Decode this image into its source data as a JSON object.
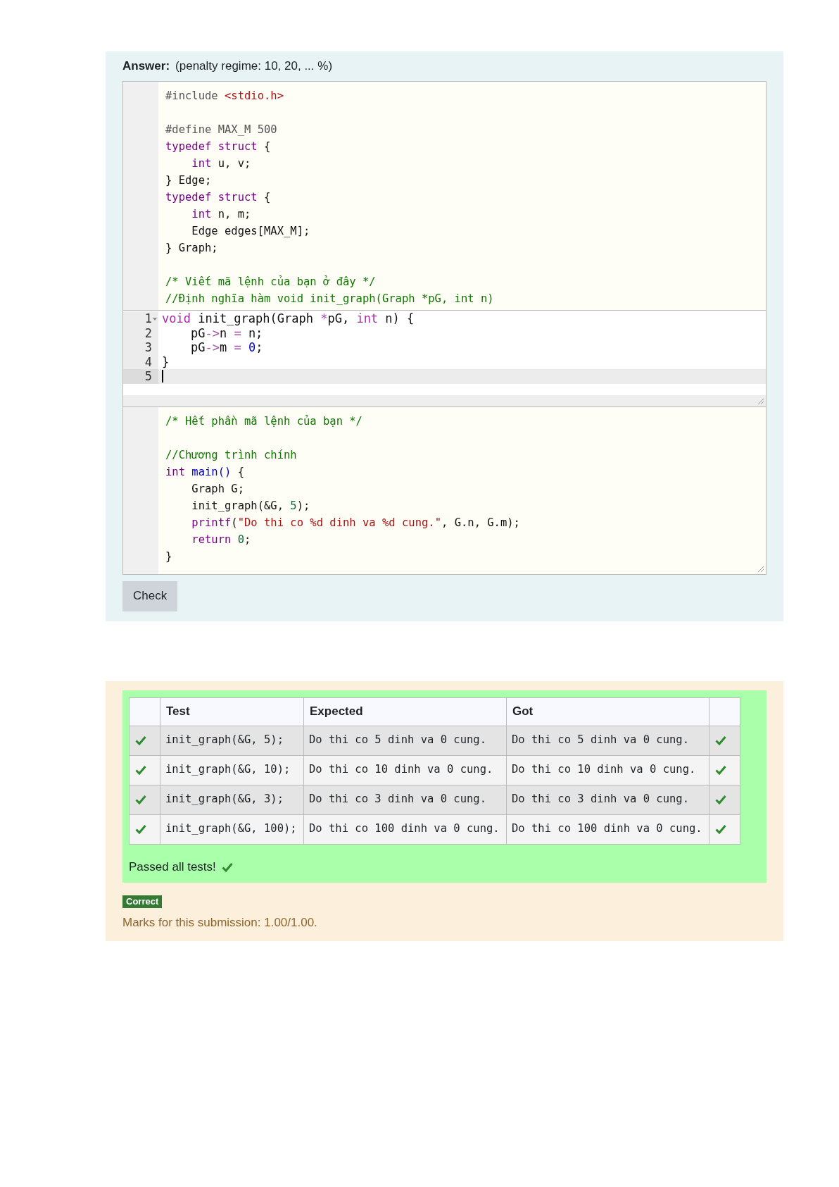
{
  "answer": {
    "label": "Answer:",
    "penalty": "(penalty regime: 10, 20, ... %)",
    "prefix_code": [
      {
        "kind": "code",
        "tokens": [
          {
            "kind": "meta",
            "text": "#include "
          },
          {
            "kind": "string",
            "text": "<stdio.h>"
          }
        ]
      },
      {
        "kind": "blank"
      },
      {
        "kind": "code",
        "tokens": [
          {
            "kind": "meta",
            "text": "#define MAX_M 500"
          }
        ]
      },
      {
        "kind": "code",
        "tokens": [
          {
            "kind": "keyword",
            "text": "typedef struct"
          },
          {
            "kind": "plain",
            "text": " {"
          }
        ]
      },
      {
        "kind": "code",
        "tokens": [
          {
            "kind": "keyword",
            "text": "    int"
          },
          {
            "kind": "plain",
            "text": " u, v;"
          }
        ]
      },
      {
        "kind": "code",
        "tokens": [
          {
            "kind": "plain",
            "text": "} Edge;"
          }
        ]
      },
      {
        "kind": "code",
        "tokens": [
          {
            "kind": "keyword",
            "text": "typedef struct"
          },
          {
            "kind": "plain",
            "text": " {"
          }
        ]
      },
      {
        "kind": "code",
        "tokens": [
          {
            "kind": "keyword",
            "text": "    int"
          },
          {
            "kind": "plain",
            "text": " n, m;"
          }
        ]
      },
      {
        "kind": "code",
        "tokens": [
          {
            "kind": "plain",
            "text": "    Edge edges[MAX_M];"
          }
        ]
      },
      {
        "kind": "code",
        "tokens": [
          {
            "kind": "plain",
            "text": "} Graph;"
          }
        ]
      },
      {
        "kind": "blank"
      },
      {
        "kind": "code",
        "tokens": [
          {
            "kind": "comment",
            "text": "/* Viết mã lệnh của bạn ở đây */"
          }
        ]
      },
      {
        "kind": "code",
        "tokens": [
          {
            "kind": "comment",
            "text": "//Định nghĩa hàm void init_graph(Graph *pG, int n)"
          }
        ]
      }
    ],
    "editor": {
      "lines": [
        {
          "number": "1",
          "foldable": true,
          "active": false,
          "tokens": [
            {
              "kind": "keyword",
              "text": "void"
            },
            {
              "kind": "plain",
              "text": " init_graph(Graph "
            },
            {
              "kind": "operator",
              "text": "*"
            },
            {
              "kind": "plain",
              "text": "pG, "
            },
            {
              "kind": "keyword",
              "text": "int"
            },
            {
              "kind": "plain",
              "text": " n) {"
            }
          ]
        },
        {
          "number": "2",
          "foldable": false,
          "active": false,
          "tokens": [
            {
              "kind": "plain",
              "text": "    pG"
            },
            {
              "kind": "operator",
              "text": "->"
            },
            {
              "kind": "plain",
              "text": "n "
            },
            {
              "kind": "operator",
              "text": "="
            },
            {
              "kind": "plain",
              "text": " n;"
            }
          ]
        },
        {
          "number": "3",
          "foldable": false,
          "active": false,
          "tokens": [
            {
              "kind": "plain",
              "text": "    pG"
            },
            {
              "kind": "operator",
              "text": "->"
            },
            {
              "kind": "plain",
              "text": "m "
            },
            {
              "kind": "operator",
              "text": "="
            },
            {
              "kind": "number",
              "text": " 0"
            },
            {
              "kind": "plain",
              "text": ";"
            }
          ]
        },
        {
          "number": "4",
          "foldable": false,
          "active": false,
          "tokens": [
            {
              "kind": "plain",
              "text": "}"
            }
          ]
        },
        {
          "number": "5",
          "foldable": false,
          "active": true
        }
      ]
    },
    "suffix_code": [
      {
        "kind": "code",
        "tokens": [
          {
            "kind": "comment",
            "text": "/* Hết phần mã lệnh của bạn */"
          }
        ]
      },
      {
        "kind": "blank"
      },
      {
        "kind": "code",
        "tokens": [
          {
            "kind": "comment",
            "text": "//Chương trình chính"
          }
        ]
      },
      {
        "kind": "code",
        "tokens": [
          {
            "kind": "keyword",
            "text": "int"
          },
          {
            "kind": "function",
            "text": " main()"
          },
          {
            "kind": "plain",
            "text": " {"
          }
        ]
      },
      {
        "kind": "code",
        "tokens": [
          {
            "kind": "plain",
            "text": "    Graph G;"
          }
        ]
      },
      {
        "kind": "code",
        "tokens": [
          {
            "kind": "plain",
            "text": "    init_graph(&G, "
          },
          {
            "kind": "number",
            "text": "5"
          },
          {
            "kind": "plain",
            "text": ");"
          }
        ]
      },
      {
        "kind": "code",
        "tokens": [
          {
            "kind": "keyword",
            "text": "    printf"
          },
          {
            "kind": "plain",
            "text": "("
          },
          {
            "kind": "string",
            "text": "\"Do thi co %d dinh va %d cung.\""
          },
          {
            "kind": "plain",
            "text": ", G.n, G.m);"
          }
        ]
      },
      {
        "kind": "code",
        "tokens": [
          {
            "kind": "keyword",
            "text": "    return"
          },
          {
            "kind": "number",
            "text": " 0"
          },
          {
            "kind": "plain",
            "text": ";"
          }
        ]
      },
      {
        "kind": "code",
        "tokens": [
          {
            "kind": "plain",
            "text": "}"
          }
        ]
      }
    ],
    "check_button": "Check"
  },
  "result": {
    "columns": {
      "test": "Test",
      "expected": "Expected",
      "got": "Got"
    },
    "rows": [
      {
        "test": "init_graph(&G, 5);",
        "expected": "Do thi co 5 dinh va 0 cung.",
        "got": "Do thi co 5 dinh va 0 cung.",
        "passed": true
      },
      {
        "test": "init_graph(&G, 10);",
        "expected": "Do thi co 10 dinh va 0 cung.",
        "got": "Do thi co 10 dinh va 0 cung.",
        "passed": true
      },
      {
        "test": "init_graph(&G, 3);",
        "expected": "Do thi co 3 dinh va 0 cung.",
        "got": "Do thi co 3 dinh va 0 cung.",
        "passed": true
      },
      {
        "test": "init_graph(&G, 100);",
        "expected": "Do thi co 100 dinh va 0 cung.",
        "got": "Do thi co 100 dinh va 0 cung.",
        "passed": true
      }
    ],
    "summary": {
      "text": "Passed all tests!",
      "passed": true
    },
    "grade": "Correct",
    "marks": "Marks for this submission: 1.00/1.00."
  }
}
